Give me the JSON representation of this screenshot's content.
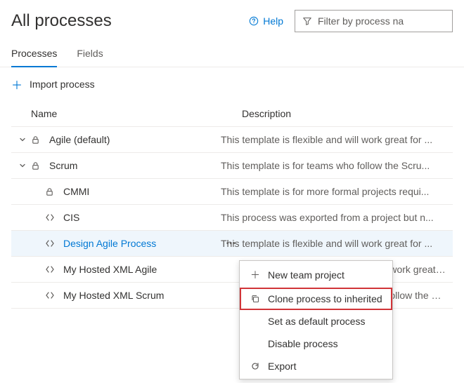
{
  "header": {
    "title": "All processes",
    "help_label": "Help",
    "filter_placeholder": "Filter by process na"
  },
  "tabs": {
    "processes": "Processes",
    "fields": "Fields"
  },
  "toolbar": {
    "import_label": "Import process"
  },
  "table": {
    "col_name": "Name",
    "col_desc": "Description",
    "rows": [
      {
        "name": "Agile (default)",
        "desc": "This template is flexible and will work great for ..."
      },
      {
        "name": "Scrum",
        "desc": "This template is for teams who follow the Scru..."
      },
      {
        "name": "CMMI",
        "desc": "This template is for more formal projects requi..."
      },
      {
        "name": "CIS",
        "desc": "This process was exported from a project but n..."
      },
      {
        "name": "Design Agile Process",
        "desc": "This template is flexible and will work great for ..."
      },
      {
        "name": "My Hosted XML Agile",
        "desc": "l will work great for ..."
      },
      {
        "name": "My Hosted XML Scrum",
        "desc": "vho follow the Scru..."
      }
    ]
  },
  "context_menu": {
    "new_team": "New team project",
    "clone": "Clone process to inherited",
    "set_default": "Set as default process",
    "disable": "Disable process",
    "export": "Export"
  }
}
